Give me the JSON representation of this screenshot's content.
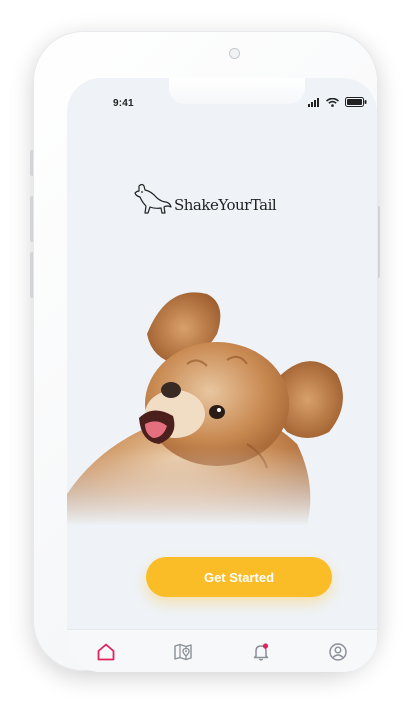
{
  "status_bar": {
    "time": "9:41",
    "icons": [
      "signal-icon",
      "wifi-icon",
      "battery-icon"
    ]
  },
  "brand": {
    "name": "ShakeYourTail",
    "logo_icon": "dog-silhouette-icon"
  },
  "hero": {
    "image": "happy-dog-photo"
  },
  "cta": {
    "label": "Get Started",
    "color": "#fbbd27"
  },
  "tab_bar": {
    "active_color": "#e0245e",
    "inactive_color": "#8a8f98",
    "items": [
      {
        "icon": "home-icon",
        "active": true
      },
      {
        "icon": "map-pin-icon",
        "active": false
      },
      {
        "icon": "bell-icon",
        "active": false,
        "badge": true
      },
      {
        "icon": "profile-icon",
        "active": false
      }
    ]
  }
}
